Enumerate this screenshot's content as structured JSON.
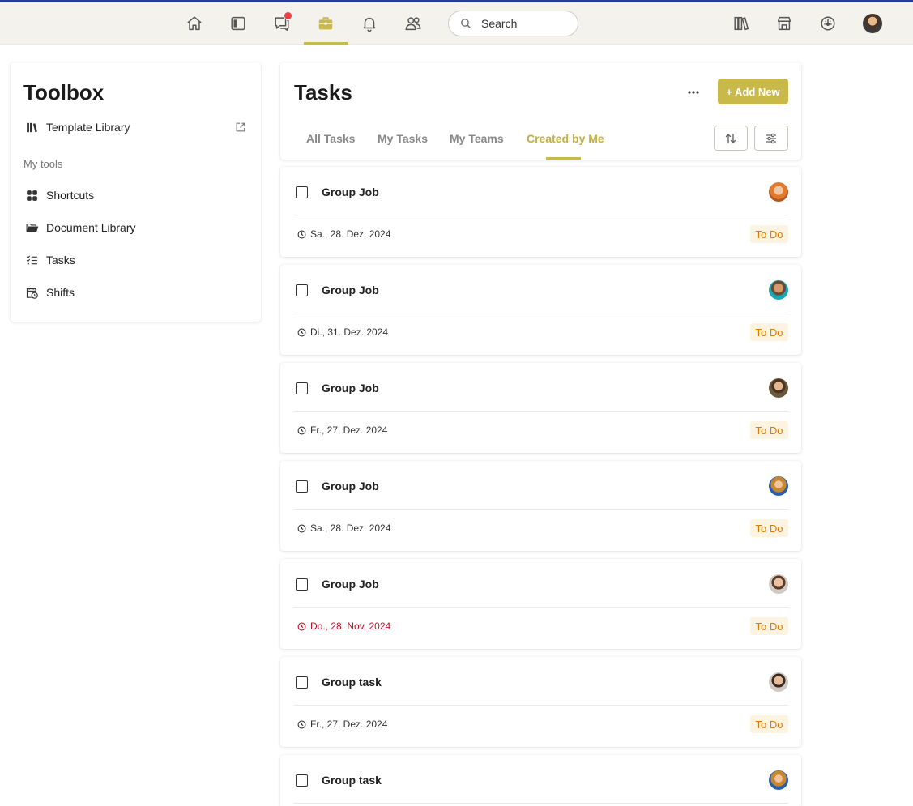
{
  "search": {
    "placeholder": "Search"
  },
  "toolbox": {
    "title": "Toolbox",
    "template_library": "Template Library",
    "section_label": "My tools",
    "items": [
      {
        "label": "Shortcuts",
        "icon": "grid-icon"
      },
      {
        "label": "Document Library",
        "icon": "folder-open-icon"
      },
      {
        "label": "Tasks",
        "icon": "checklist-icon"
      },
      {
        "label": "Shifts",
        "icon": "calendar-clock-icon"
      }
    ]
  },
  "tasks": {
    "title": "Tasks",
    "add_label": "+ Add New",
    "tabs": [
      "All Tasks",
      "My Tasks",
      "My Teams",
      "Created by Me"
    ],
    "active_tab": "Created by Me",
    "items": [
      {
        "title": "Group Job",
        "date": "Sa., 28. Dez. 2024",
        "status": "To Do",
        "overdue": false
      },
      {
        "title": "Group Job",
        "date": "Di., 31. Dez. 2024",
        "status": "To Do",
        "overdue": false
      },
      {
        "title": "Group Job",
        "date": "Fr., 27. Dez. 2024",
        "status": "To Do",
        "overdue": false
      },
      {
        "title": "Group Job",
        "date": "Sa., 28. Dez. 2024",
        "status": "To Do",
        "overdue": false
      },
      {
        "title": "Group Job",
        "date": "Do., 28. Nov. 2024",
        "status": "To Do",
        "overdue": true
      },
      {
        "title": "Group task",
        "date": "Fr., 27. Dez. 2024",
        "status": "To Do",
        "overdue": false
      },
      {
        "title": "Group task"
      }
    ]
  },
  "colors": {
    "accent": "#c9b84a",
    "top_line": "#1f3f8f",
    "status_text": "#e07b00",
    "status_bg": "#fdf3e1",
    "overdue": "#c0102c",
    "notification": "#ef3f46"
  }
}
